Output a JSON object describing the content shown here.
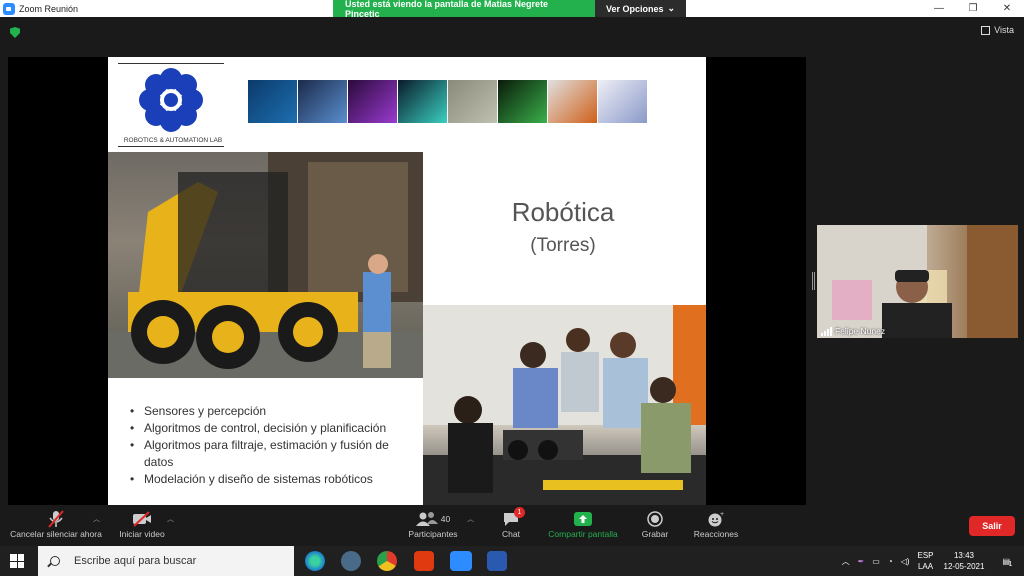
{
  "window": {
    "title": "Zoom Reunión"
  },
  "share_banner": {
    "message": "Usted está viendo la pantalla de Matias Negrete Pincetic",
    "options_label": "Ver Opciones"
  },
  "view": {
    "label": "Vista"
  },
  "slide": {
    "logo_text": "ROBOTICS & AUTOMATION LAB",
    "title": "Robótica",
    "subtitle": "(Torres)",
    "bullets": [
      "Sensores y percepción",
      "Algoritmos de control, decisión y planificación",
      "Algoritmos para filtraje, estimación y fusión de datos",
      "Modelación y diseño de sistemas robóticos"
    ]
  },
  "participant": {
    "name": "Felipe Nunez"
  },
  "toolbar": {
    "mute_label": "Cancelar silenciar ahora",
    "video_label": "Iniciar video",
    "participants_label": "Participantes",
    "participants_count": "40",
    "chat_label": "Chat",
    "chat_badge": "1",
    "share_label": "Compartir pantalla",
    "record_label": "Grabar",
    "reactions_label": "Reacciones",
    "leave_label": "Salir"
  },
  "taskbar": {
    "search_placeholder": "Escribe aquí para buscar",
    "lang_top": "ESP",
    "lang_bottom": "LAA",
    "time": "13:43",
    "date": "12-05-2021",
    "notif_count": "1"
  },
  "colors": {
    "green": "#23b14d",
    "red": "#e02828",
    "zoom_blue": "#2d8cff"
  }
}
